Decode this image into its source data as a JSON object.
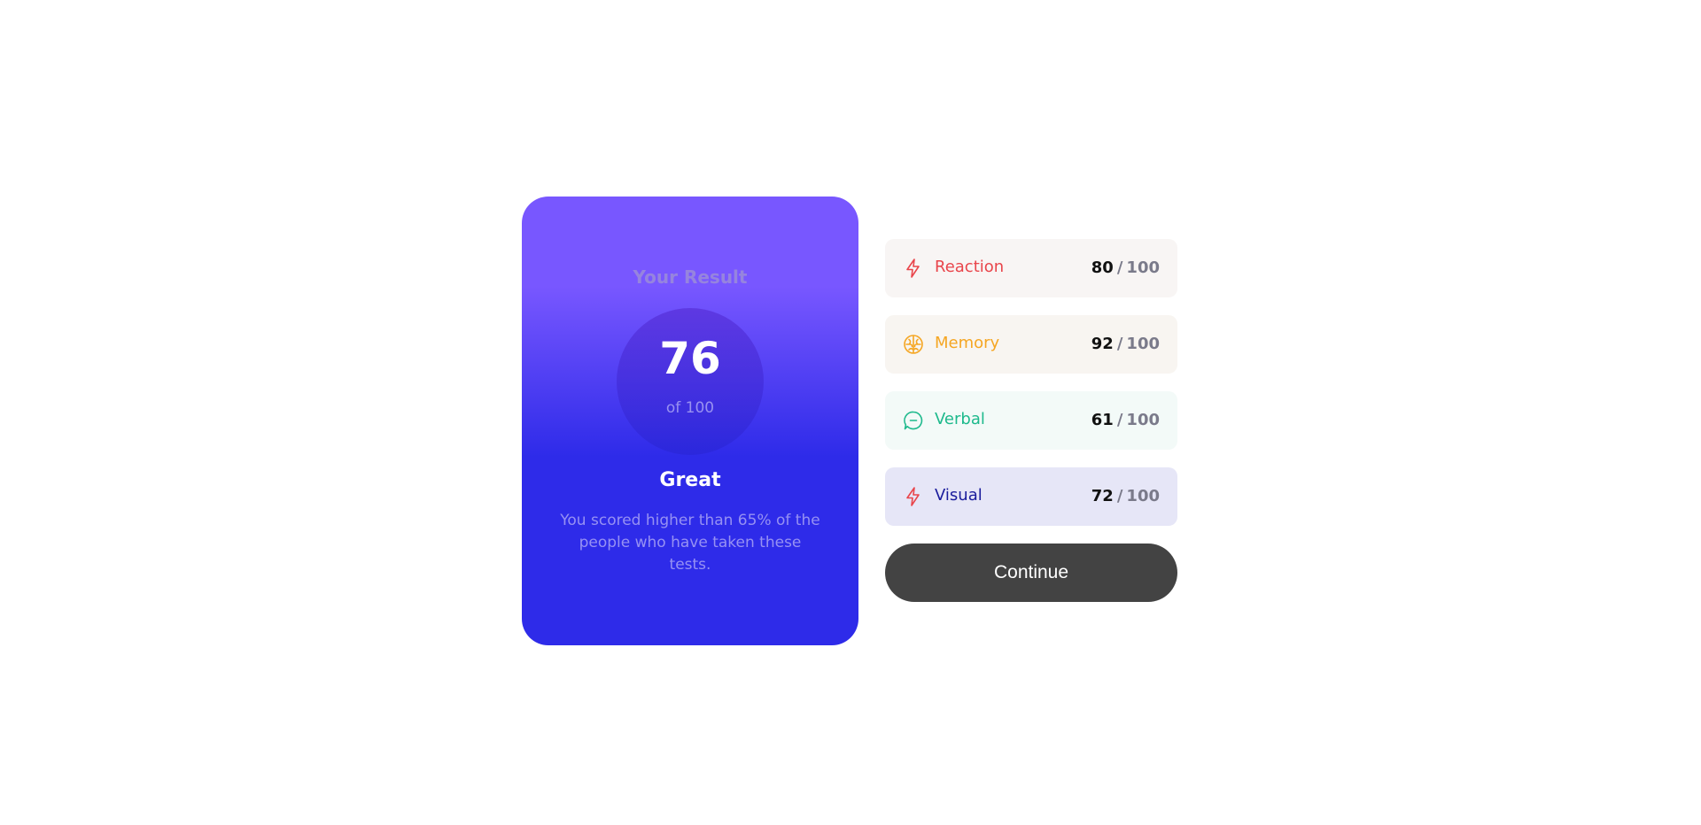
{
  "result": {
    "title": "Your Result",
    "score": "76",
    "of_label": "of 100",
    "rating": "Great",
    "description": "You scored higher than 65% of the people who have taken these tests."
  },
  "summary": {
    "categories": [
      {
        "label": "Reaction",
        "score": "80",
        "separator": "/",
        "max": "100",
        "icon": "lightning-icon",
        "color": "#e9454b",
        "bg": "#f8f5f4"
      },
      {
        "label": "Memory",
        "score": "92",
        "separator": "/",
        "max": "100",
        "icon": "brain-icon",
        "color": "#f5a623",
        "bg": "#f8f5f1"
      },
      {
        "label": "Verbal",
        "score": "61",
        "separator": "/",
        "max": "100",
        "icon": "chat-bubble-icon",
        "color": "#1db98c",
        "bg": "#f3faf8"
      },
      {
        "label": "Visual",
        "score": "72",
        "separator": "/",
        "max": "100",
        "icon": "lightning-icon",
        "color": "#1a1c9c",
        "bg": "#e6e6f7"
      }
    ],
    "continue_label": "Continue"
  }
}
